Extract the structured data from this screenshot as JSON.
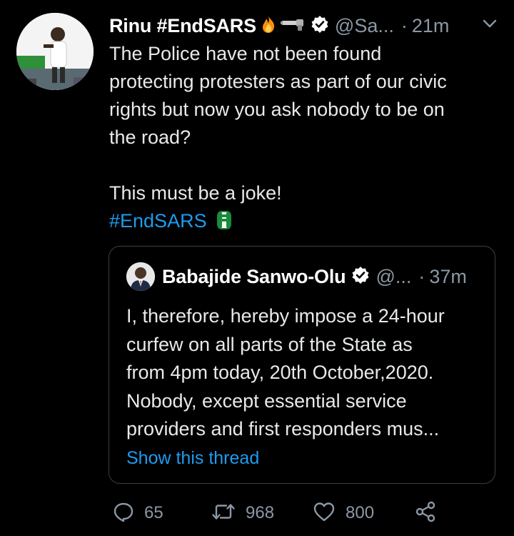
{
  "tweet": {
    "author": {
      "display_name": "Rinu #EndSARS",
      "emojis": [
        "fire-emoji",
        "gun-emoji"
      ],
      "handle": "@Sa...",
      "timestamp": "21m"
    },
    "body_lines": [
      "The Police have not been found",
      "protecting protesters as part of our civic",
      "rights but now you ask nobody to be on",
      "the road?"
    ],
    "body_line_2": "This must be a joke!",
    "hashtag": "#EndSARS",
    "hashtag_emoji": "endsars-fist-emoji"
  },
  "quoted_tweet": {
    "author": {
      "display_name": "Babajide Sanwo-Olu",
      "handle": "@...",
      "timestamp": "37m"
    },
    "text_lines": [
      "I, therefore, hereby impose a 24-hour",
      "curfew on all parts of the State as",
      "from 4pm today, 20th October,2020.",
      "Nobody, except essential service",
      "providers and first responders mus..."
    ],
    "show_thread_label": "Show this thread"
  },
  "actions": {
    "reply_count": "65",
    "retweet_count": "968",
    "like_count": "800"
  },
  "colors": {
    "background": "#000000",
    "link_blue": "#1d9bf0",
    "secondary_text": "#8b98a5",
    "primary_text": "#e7e9ea"
  }
}
